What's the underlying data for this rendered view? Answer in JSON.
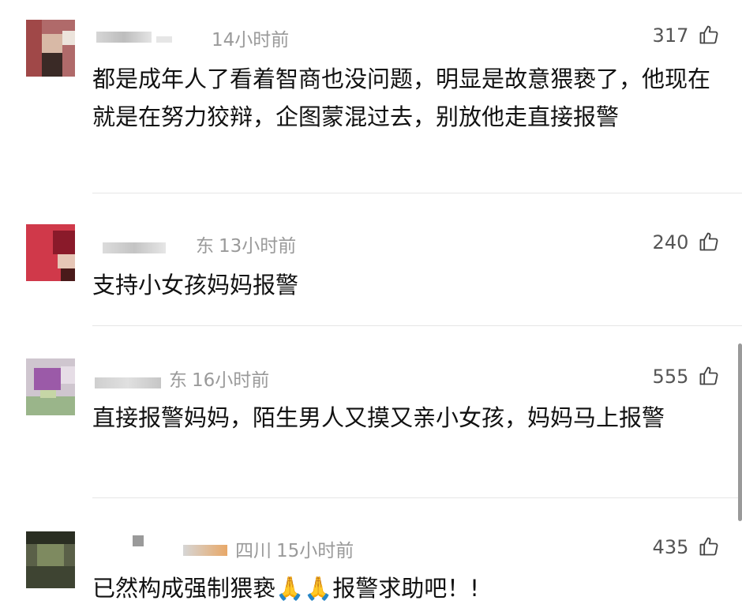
{
  "comments": [
    {
      "location": "",
      "time": "14小时前",
      "likes": "317",
      "text": "都是成年人了看着智商也没问题，明显是故意猥亵了，他现在就是在努力狡辩，企图蒙混过去，别放他走直接报警"
    },
    {
      "location": "东",
      "time": "13小时前",
      "likes": "240",
      "text": "支持小女孩妈妈报警"
    },
    {
      "location": "东",
      "time": "16小时前",
      "likes": "555",
      "text": "直接报警妈妈，陌生男人又摸又亲小女孩，妈妈马上报警"
    },
    {
      "location": "四川",
      "time": "15小时前",
      "likes": "435",
      "text": "已然构成强制猥亵🙏🙏报警求助吧！!"
    }
  ],
  "icons": {
    "like": "thumbs-up-icon"
  }
}
